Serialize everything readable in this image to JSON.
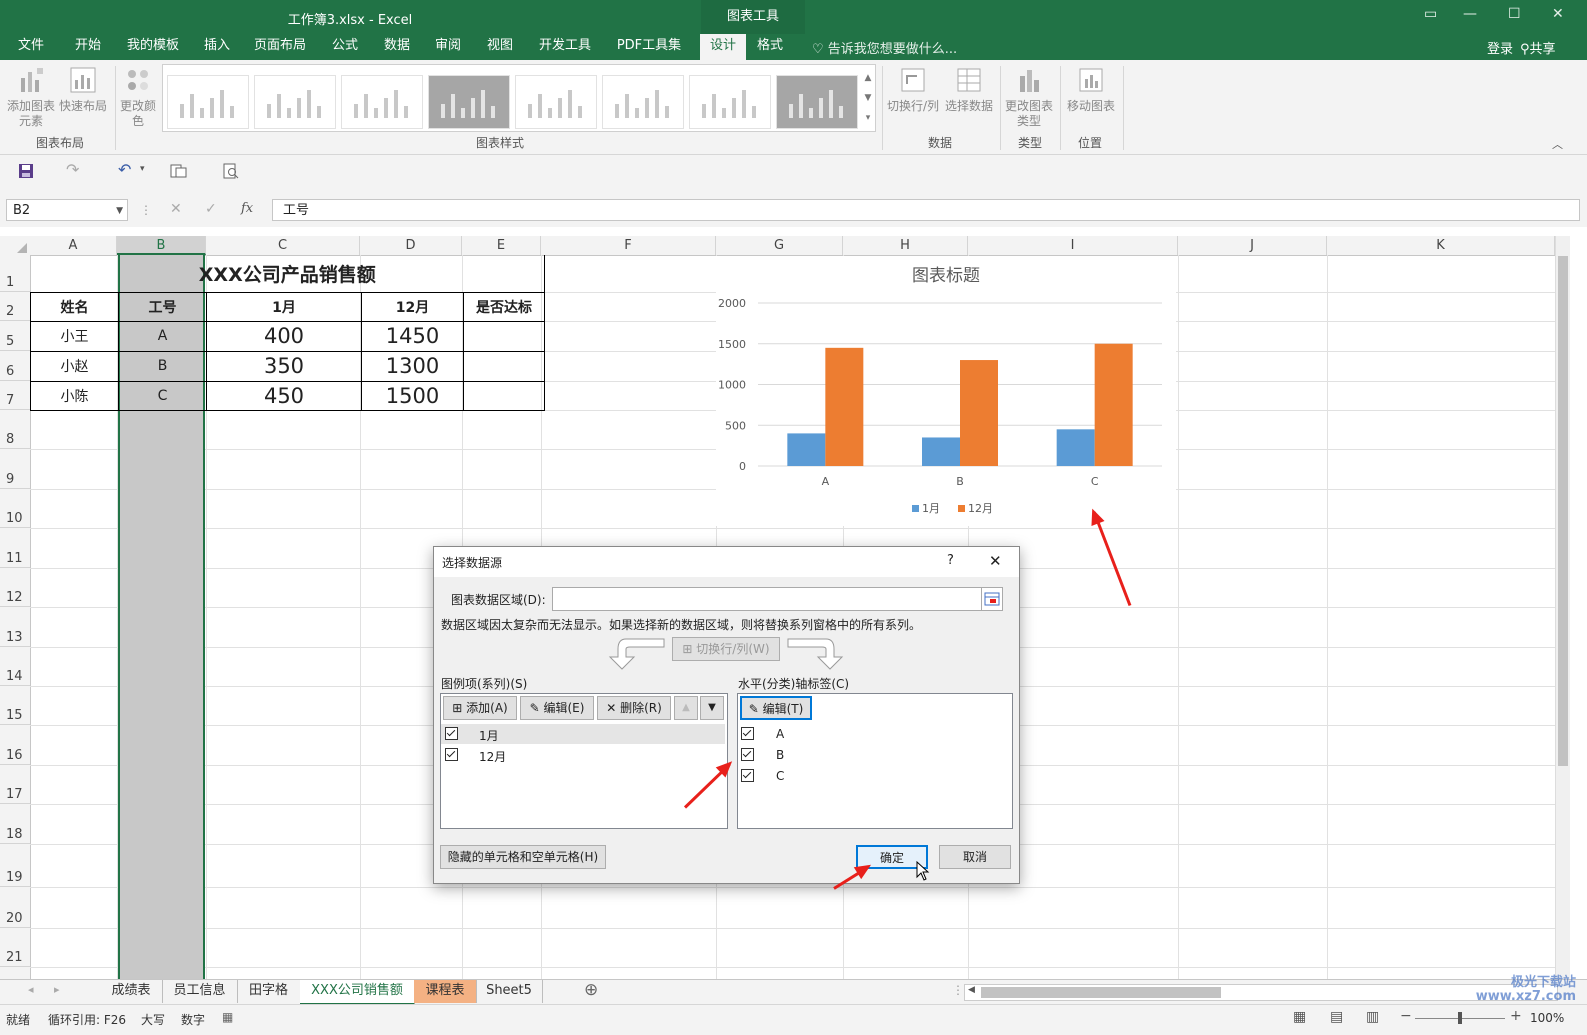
{
  "window": {
    "title": "工作簿3.xlsx - Excel",
    "context_group": "图表工具",
    "login": "登录",
    "share": "共享",
    "tell_me": "告诉我您想要做什么..."
  },
  "ribbon_tabs": [
    "文件",
    "开始",
    "我的模板",
    "插入",
    "页面布局",
    "公式",
    "数据",
    "审阅",
    "视图",
    "开发工具",
    "PDF工具集",
    "设计",
    "格式"
  ],
  "active_tab": "设计",
  "ribbon": {
    "add_element": "添加图表元素",
    "quick_layout": "快速布局",
    "change_color": "更改颜色",
    "group_layout": "图表布局",
    "group_styles": "图表样式",
    "switch_rowcol": "切换行/列",
    "select_data": "选择数据",
    "group_data": "数据",
    "change_type": "更改图表类型",
    "group_type": "类型",
    "move_chart": "移动图表",
    "group_location": "位置"
  },
  "formula_bar": {
    "name_box": "B2",
    "fx": "fx",
    "content": "工号"
  },
  "columns": [
    "A",
    "B",
    "C",
    "D",
    "E",
    "F",
    "G",
    "H",
    "I",
    "J",
    "K"
  ],
  "rows": [
    "1",
    "2",
    "5",
    "6",
    "7",
    "8",
    "9",
    "10",
    "11",
    "12",
    "13",
    "14",
    "15",
    "16",
    "17",
    "18",
    "19",
    "20",
    "21"
  ],
  "table": {
    "title": "XXX公司产品销售额",
    "headers": [
      "姓名",
      "工号",
      "1月",
      "12月",
      "是否达标"
    ],
    "rows": [
      [
        "小王",
        "A",
        "400",
        "1450",
        ""
      ],
      [
        "小赵",
        "B",
        "350",
        "1300",
        ""
      ],
      [
        "小陈",
        "C",
        "450",
        "1500",
        ""
      ]
    ]
  },
  "chart_data": {
    "type": "bar",
    "title": "图表标题",
    "categories": [
      "A",
      "B",
      "C"
    ],
    "series": [
      {
        "name": "1月",
        "values": [
          400,
          350,
          450
        ],
        "color": "#5b9bd5"
      },
      {
        "name": "12月",
        "values": [
          1450,
          1300,
          1500
        ],
        "color": "#ed7d31"
      }
    ],
    "ylim": [
      0,
      2000
    ],
    "yticks": [
      "0",
      "500",
      "1000",
      "1500",
      "2000"
    ],
    "grid": true,
    "legend": "bottom"
  },
  "dialog": {
    "title": "选择数据源",
    "help": "?",
    "close": "✕",
    "range_label": "图表数据区域(D):",
    "range_value": "",
    "note": "数据区域因太复杂而无法显示。如果选择新的数据区域，则将替换系列窗格中的所有系列。",
    "switch_btn": "切换行/列(W)",
    "legend_label": "图例项(系列)(S)",
    "add_btn": "添加(A)",
    "edit_btn": "编辑(E)",
    "delete_btn": "删除(R)",
    "series_items": [
      "1月",
      "12月"
    ],
    "axis_label": "水平(分类)轴标签(C)",
    "axis_edit_btn": "编辑(T)",
    "axis_items": [
      "A",
      "B",
      "C"
    ],
    "hidden_btn": "隐藏的单元格和空单元格(H)",
    "ok_btn": "确定",
    "cancel_btn": "取消"
  },
  "sheet_tabs": [
    "成绩表",
    "员工信息",
    "田字格",
    "XXX公司销售额",
    "课程表",
    "Sheet5"
  ],
  "active_sheet": "XXX公司销售额",
  "status": {
    "ready": "就绪",
    "circular": "循环引用: F26",
    "caps": "大写",
    "num": "数字",
    "zoom": "100%"
  },
  "watermark": "极光下载站 www.xz7.com"
}
